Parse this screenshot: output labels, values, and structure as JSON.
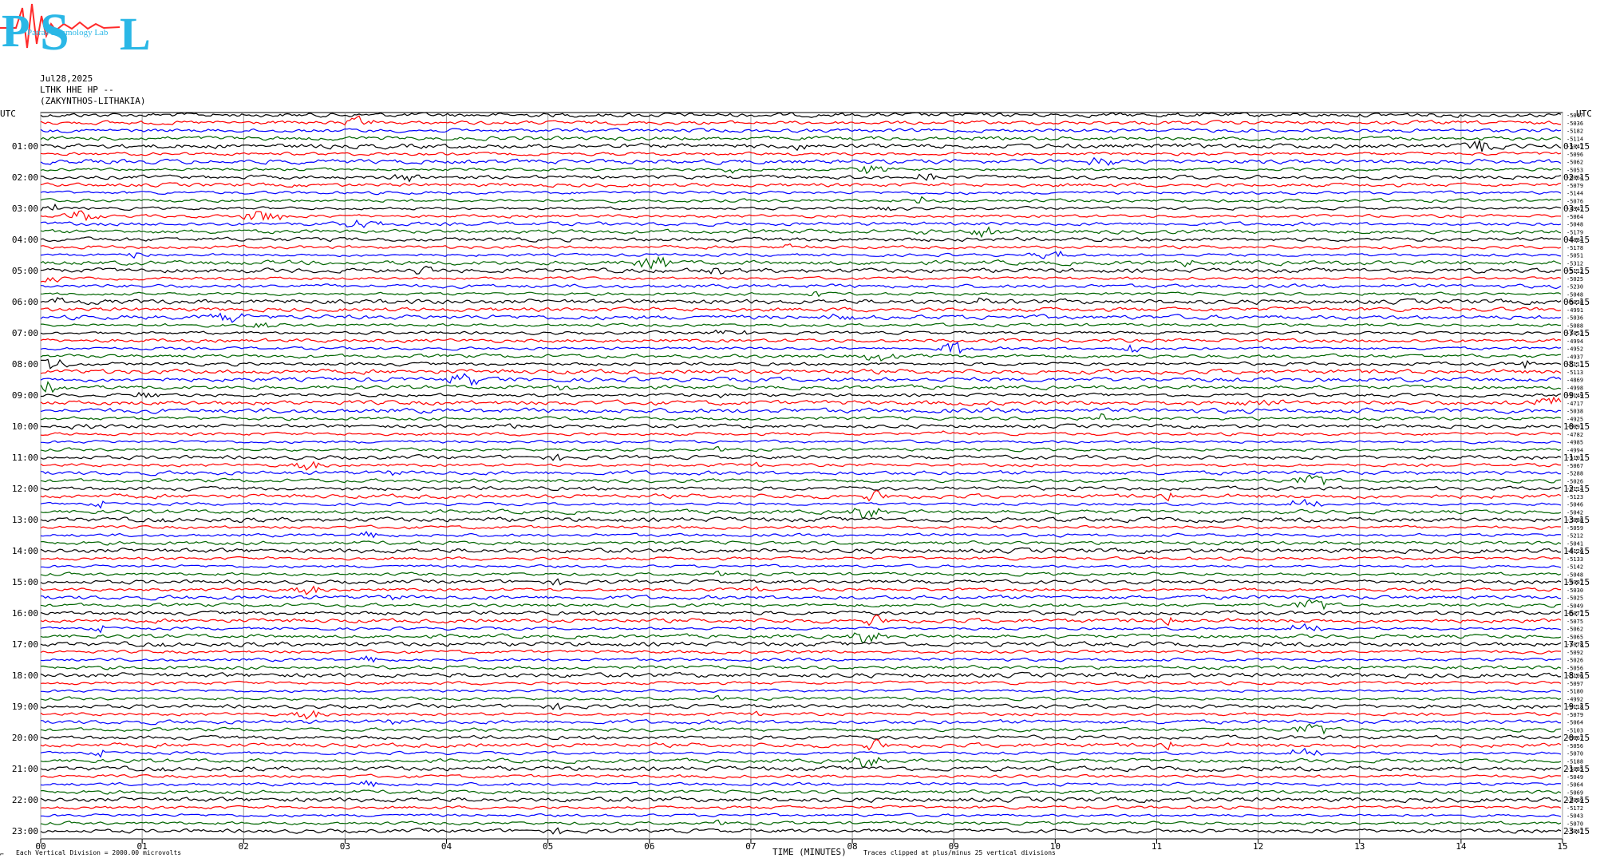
{
  "logo": {
    "letters": [
      "P",
      "S",
      "L"
    ],
    "text": "Patras Seismology Lab"
  },
  "header": {
    "date": "Jul28,2025",
    "station": "LTHK HHE HP --",
    "location": "(ZAKYNTHOS-LITHAKIA)"
  },
  "footer": {
    "scale_note": "Each Vertical Division = 2000.00 microvolts",
    "clip_note": "Traces clipped at plus/minus 25 vertical divisions",
    "corner_mark": "⌐"
  },
  "chart_data": {
    "type": "line",
    "title": "",
    "xlabel": "TIME (MINUTES)",
    "ylabel": "",
    "utc_label": "UTC",
    "x_ticks": [
      "00",
      "01",
      "02",
      "03",
      "04",
      "05",
      "06",
      "07",
      "08",
      "09",
      "10",
      "11",
      "12",
      "13",
      "14",
      "15"
    ],
    "xlim": [
      0,
      15
    ],
    "grid": true,
    "colors": [
      "#000000",
      "#ff0000",
      "#0000ff",
      "#006400"
    ],
    "left_hour_labels": [
      "01:00",
      "02:00",
      "03:00",
      "04:00",
      "05:00",
      "06:00",
      "07:00",
      "08:00",
      "09:00",
      "10:00",
      "11:00",
      "12:00",
      "13:00",
      "14:00",
      "15:00",
      "16:00",
      "17:00",
      "18:00",
      "19:00",
      "20:00",
      "21:00",
      "22:00",
      "23:00"
    ],
    "right_hour_labels": [
      "01:15",
      "02:15",
      "03:15",
      "04:15",
      "05:15",
      "06:15",
      "07:15",
      "08:15",
      "09:15",
      "10:15",
      "11:15",
      "12:15",
      "13:15",
      "14:15",
      "15:15",
      "16:15",
      "17:15",
      "18:15",
      "19:15",
      "20:15",
      "21:15",
      "22:15",
      "23:15"
    ],
    "trace_offsets": [
      "-5047",
      "-5036",
      "-5182",
      "-5114",
      "-5047",
      "-5096",
      "-5062",
      "-5053",
      "-5064",
      "-5079",
      "-5144",
      "-5076",
      "-4947",
      "-5064",
      "-5048",
      "-5179",
      "-5084",
      "-5178",
      "-5051",
      "-5312",
      "-5112",
      "-5025",
      "-5230",
      "-5048",
      "-5038",
      "-4991",
      "-5036",
      "-5088",
      "-5053",
      "-4994",
      "-4952",
      "-4937",
      "-5111",
      "-5113",
      "-4869",
      "-4998",
      "-5149",
      "-4717",
      "-5038",
      "-4925",
      "-5091",
      "-4782",
      "-4985",
      "-4994",
      "-5101",
      "-5067",
      "-5288",
      "-5026",
      "-5114",
      "-5123",
      "-5046",
      "-5042",
      "-5088",
      "-5059",
      "-5212",
      "-5041",
      "-5126",
      "-5133",
      "-5142",
      "-5048",
      "-4987",
      "-5030",
      "-5025",
      "-5049",
      "-5077",
      "-5075",
      "-5062",
      "-5065",
      "-5078",
      "-5092",
      "-5026",
      "-5056",
      "-5106",
      "-5097",
      "-5180",
      "-4992",
      "-5118",
      "-5079",
      "-5064",
      "-5103",
      "-5067",
      "-5056",
      "-5070",
      "-5188",
      "-5085",
      "-5049",
      "-5064",
      "-5069",
      "-5089",
      "-5172",
      "-5043",
      "-5070",
      "-5047"
    ]
  }
}
